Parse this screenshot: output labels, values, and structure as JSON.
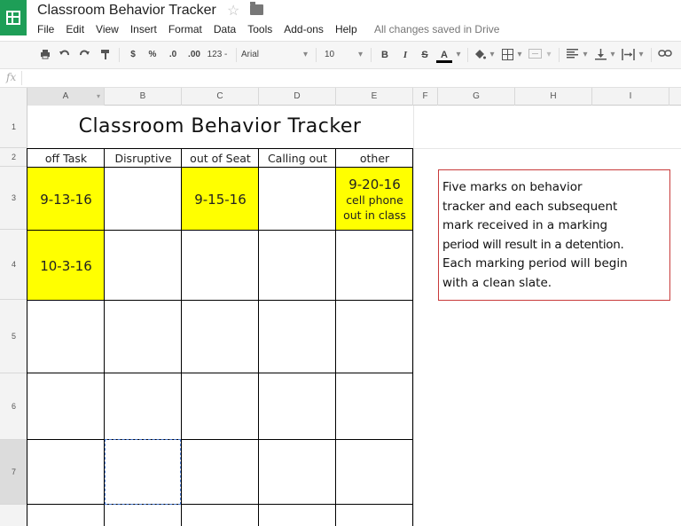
{
  "app": {
    "title": "Classroom Behavior Tracker",
    "save_status": "All changes saved in Drive",
    "menu": [
      "File",
      "Edit",
      "View",
      "Insert",
      "Format",
      "Data",
      "Tools",
      "Add-ons",
      "Help"
    ]
  },
  "toolbar": {
    "currency": "$",
    "percent": "%",
    "decrease_decimals": ".0",
    "increase_decimals": ".00",
    "more_formats": "123 -",
    "font": "Arial",
    "font_size": "10",
    "bold": "B",
    "italic": "I",
    "strikethrough": "S",
    "text_color": "A"
  },
  "formula_bar": {
    "label": "fx"
  },
  "columns": [
    "A",
    "B",
    "C",
    "D",
    "E",
    "F",
    "G",
    "H",
    "I"
  ],
  "rows": [
    "1",
    "2",
    "3",
    "4",
    "5",
    "6",
    "7"
  ],
  "sheet": {
    "title": "Classroom Behavior Tracker",
    "headers": [
      "off Task",
      "Disruptive",
      "out of Seat",
      "Calling out",
      "other"
    ],
    "row3": {
      "A": "9-13-16",
      "C": "9-15-16",
      "E_date": "9-20-16",
      "E_note_1": "cell phone",
      "E_note_2": "out in class"
    },
    "row4": {
      "A": "10-3-16"
    },
    "note": [
      "Five marks on behavior",
      "tracker and each subsequent",
      "mark received in a marking",
      "period will result in a detention.",
      "Each marking period will begin",
      "with a clean slate."
    ]
  },
  "colors": {
    "highlight": "#ffff00",
    "note_border": "#c83a3a",
    "brand": "#1e9e57",
    "selection": "#4a7bd4"
  }
}
